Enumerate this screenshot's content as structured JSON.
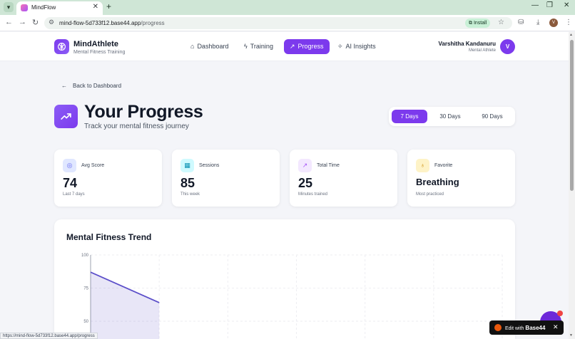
{
  "browser": {
    "tab_title": "MindFlow",
    "url_host": "mind-flow-5d733f12.base44.app",
    "url_path": "/progress",
    "install_label": "Install",
    "status_url": "https://mind-flow-5d733f12.base44.app/progress",
    "profile_initial": "V"
  },
  "header": {
    "brand_name": "MindAthlete",
    "brand_sub": "Mental Fitness Training",
    "nav": [
      {
        "label": "Dashboard",
        "icon": "home-icon"
      },
      {
        "label": "Training",
        "icon": "bolt-icon"
      },
      {
        "label": "Progress",
        "icon": "trend-icon",
        "active": true
      },
      {
        "label": "AI Insights",
        "icon": "sparkle-icon"
      }
    ],
    "user_name": "Varshitha Kandanuru",
    "user_role": "Mental Athlete",
    "avatar_initial": "V"
  },
  "page": {
    "back_label": "Back to Dashboard",
    "title": "Your Progress",
    "subtitle": "Track your mental fitness journey",
    "ranges": [
      {
        "label": "7 Days",
        "active": true
      },
      {
        "label": "30 Days"
      },
      {
        "label": "90 Days"
      }
    ]
  },
  "stats": [
    {
      "label": "Avg Score",
      "value": "74",
      "sub": "Last 7 days",
      "icon": "target-icon",
      "color": "#6366f1"
    },
    {
      "label": "Sessions",
      "value": "85",
      "sub": "This week",
      "icon": "calendar-icon",
      "color": "#0891b2"
    },
    {
      "label": "Total Time",
      "value": "25",
      "sub": "Minutes trained",
      "icon": "trend-icon",
      "color": "#a855f7"
    },
    {
      "label": "Favorite",
      "value": "Breathing",
      "sub": "Most practiced",
      "icon": "award-icon",
      "color": "#ca8a04"
    }
  ],
  "trend": {
    "title": "Mental Fitness Trend"
  },
  "chart_data": {
    "type": "area",
    "yticks": [
      "100",
      "75",
      "50"
    ],
    "ylim": [
      0,
      100
    ],
    "x": [
      0,
      1
    ],
    "values": [
      87,
      64
    ],
    "x_divisions": 6,
    "color": "#5b4ec9"
  },
  "overlay": {
    "edit_prefix": "Edit with",
    "edit_brand": "Base44"
  }
}
